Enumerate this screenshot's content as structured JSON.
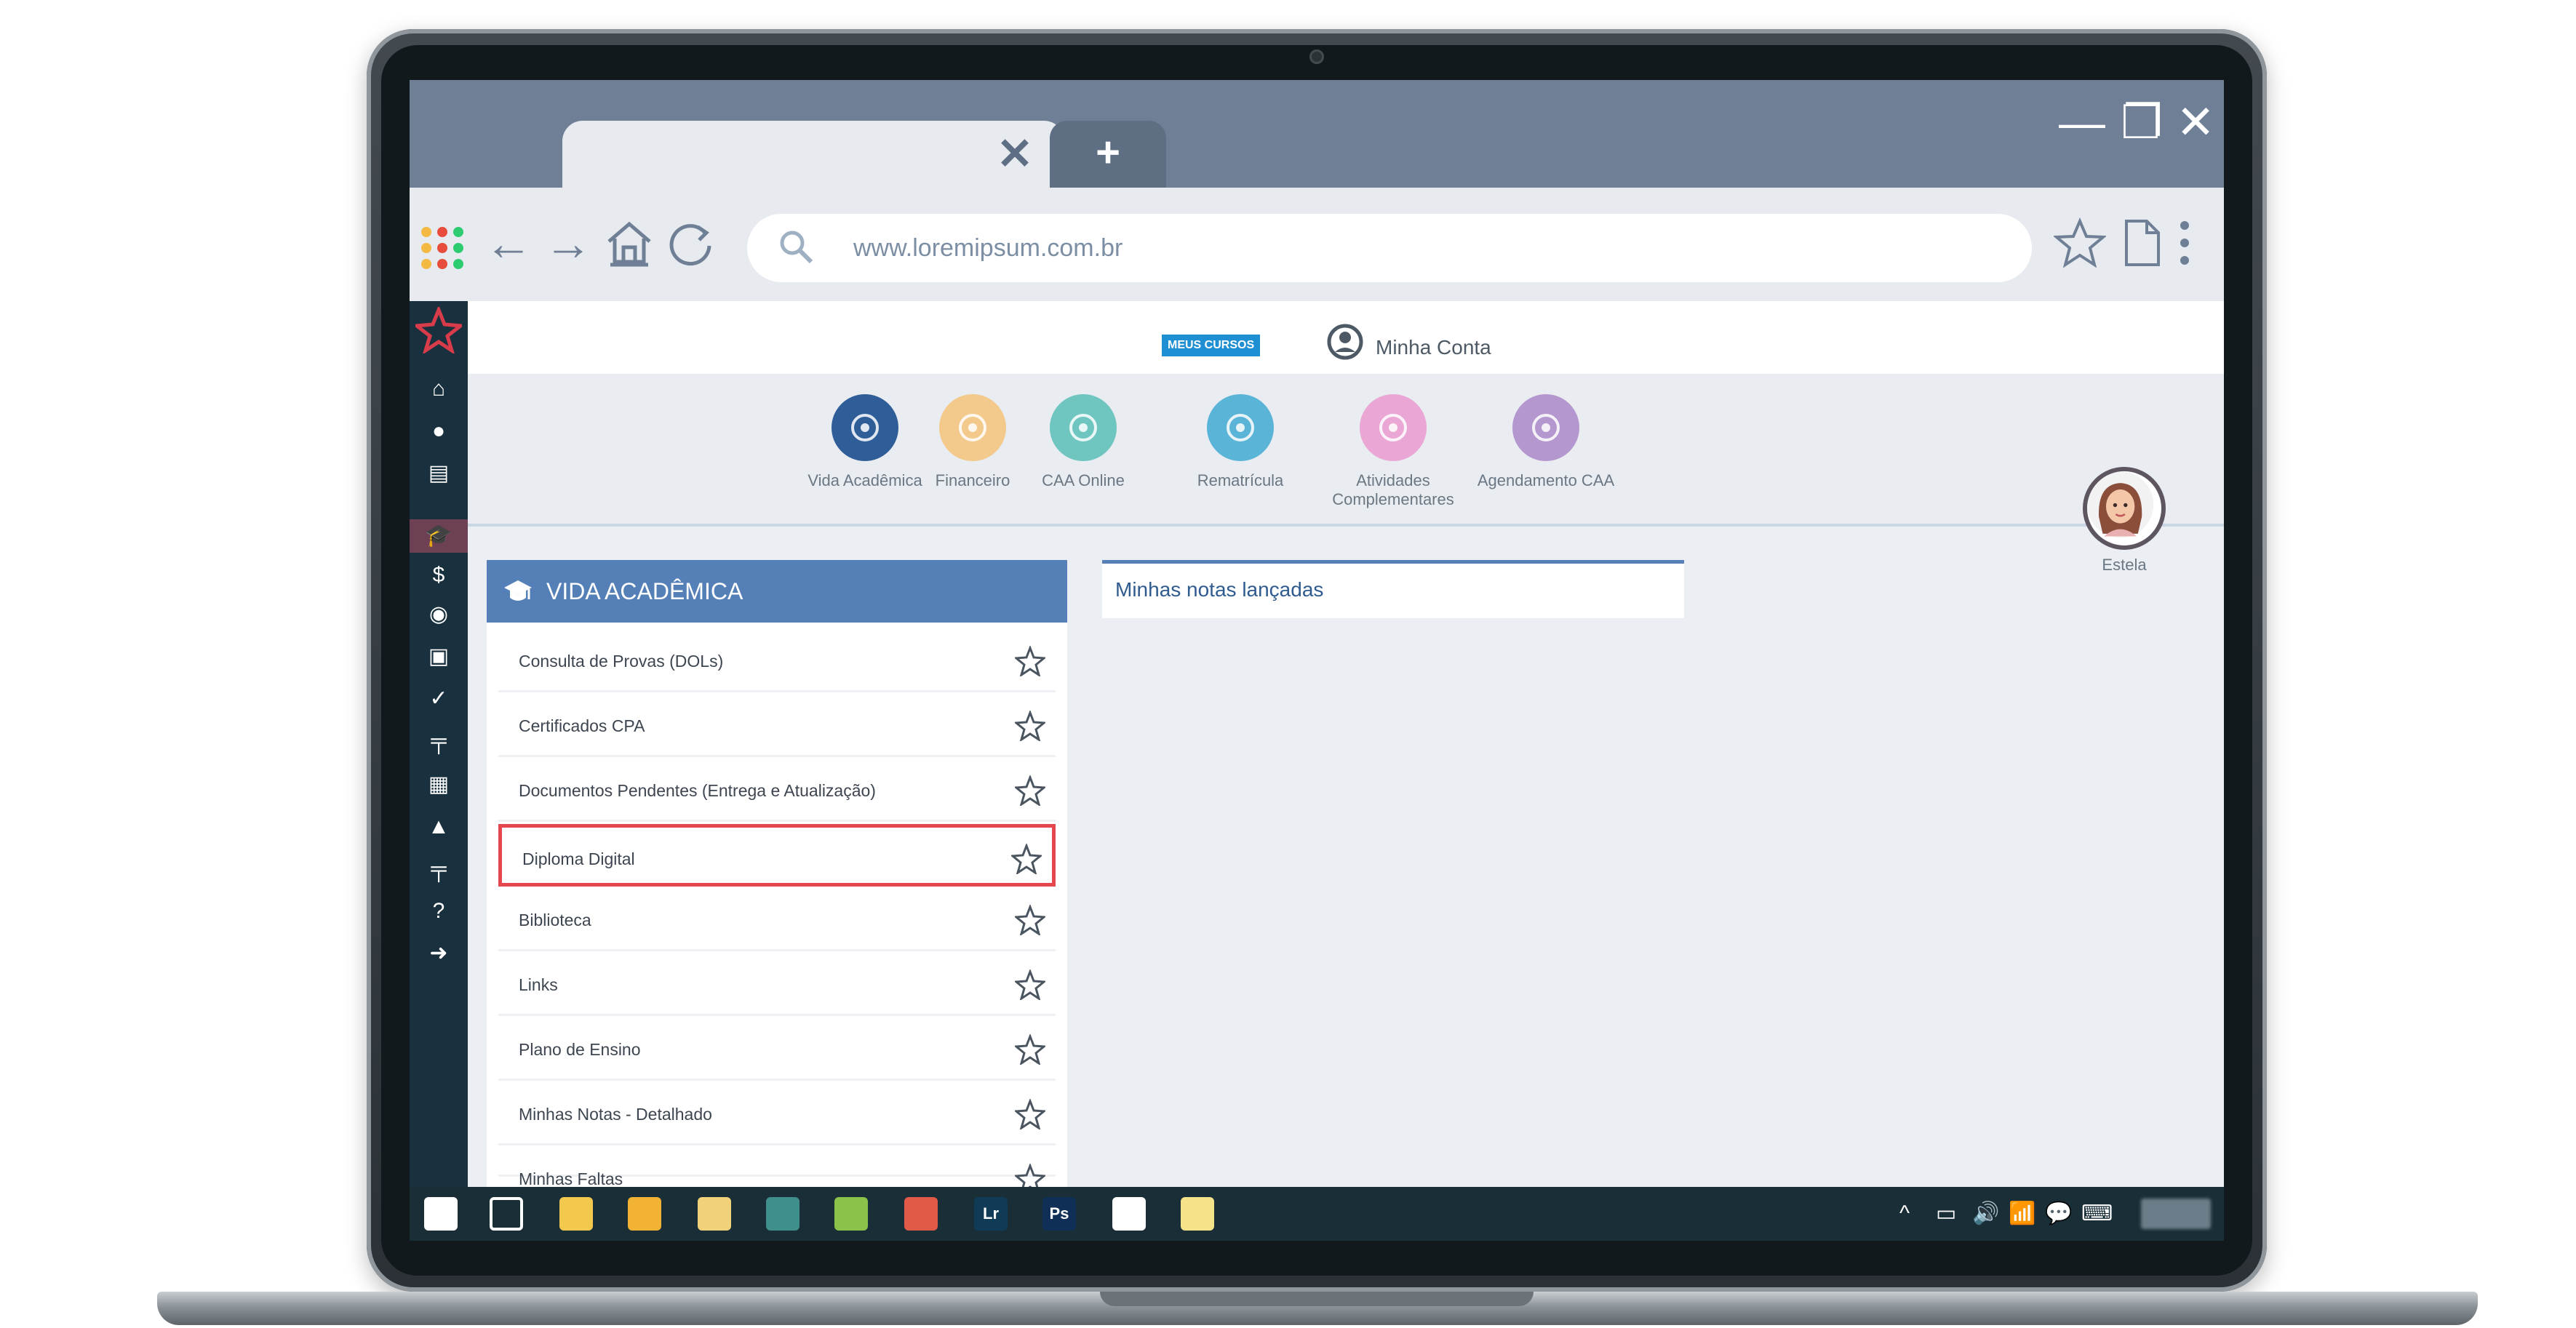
{
  "browser": {
    "tab_close": "✕",
    "new_tab": "+",
    "window_controls": {
      "minimize": "—",
      "restore": "❐",
      "close": "✕"
    },
    "url": "www.loremipsum.com.br",
    "nav_icons": [
      "apps-icon",
      "back-arrow-icon",
      "forward-arrow-icon",
      "home-icon",
      "reload-icon",
      "search-icon",
      "star-icon",
      "page-icon",
      "more-vertical-icon"
    ]
  },
  "sidebar": {
    "items": [
      {
        "icon": "home-icon",
        "glyph": "⌂"
      },
      {
        "icon": "user-icon",
        "glyph": "●"
      },
      {
        "icon": "calendar-icon",
        "glyph": "▤"
      },
      {
        "icon": "graduation-cap-icon",
        "glyph": "🎓"
      },
      {
        "icon": "dollar-icon",
        "glyph": "$"
      },
      {
        "icon": "globe-icon",
        "glyph": "◉"
      },
      {
        "icon": "id-card-icon",
        "glyph": "▣"
      },
      {
        "icon": "check-circle-icon",
        "glyph": "✓"
      },
      {
        "icon": "signpost-icon",
        "glyph": "╤"
      },
      {
        "icon": "calendar-clock-icon",
        "glyph": "▦"
      },
      {
        "icon": "bell-icon",
        "glyph": "▲"
      },
      {
        "icon": "signpost-icon",
        "glyph": "╤"
      },
      {
        "icon": "help-icon",
        "glyph": "?"
      },
      {
        "icon": "logout-icon",
        "glyph": "➜"
      }
    ]
  },
  "header": {
    "badge": "MEUS CURSOS",
    "account": "Minha Conta"
  },
  "modules": [
    {
      "label": "Vida Acadêmica",
      "color": "#2e5d97"
    },
    {
      "label": "Financeiro",
      "color": "#f3c98c"
    },
    {
      "label": "CAA Online",
      "color": "#6fc6c0"
    },
    {
      "label": "Rematrícula",
      "color": "#5ab4d8"
    },
    {
      "label": "Atividades Complementares",
      "color": "#eaa6d4"
    },
    {
      "label": "Agendamento CAA",
      "color": "#b497cf"
    }
  ],
  "user": {
    "name": "Estela"
  },
  "panel": {
    "title": "VIDA ACADÊMICA",
    "items": [
      "Consulta de Provas (DOLs)",
      "Certificados CPA",
      "Documentos Pendentes (Entrega e Atualização)",
      "Diploma Digital",
      "Biblioteca",
      "Links",
      "Plano de Ensino",
      "Minhas Notas - Detalhado",
      "Minhas Faltas"
    ],
    "highlighted_index": 3
  },
  "notes_card": {
    "title": "Minhas notas lançadas"
  },
  "taskbar": {
    "apps": [
      {
        "name": "windows-start-icon",
        "label": "",
        "bg": "#ffffff"
      },
      {
        "name": "task-view-icon",
        "label": "",
        "bg": "transparent"
      },
      {
        "name": "file-explorer-icon",
        "label": "",
        "bg": "#f2c94c"
      },
      {
        "name": "chrome-icon",
        "label": "",
        "bg": "#f2b233"
      },
      {
        "name": "app-icon",
        "label": "",
        "bg": "#f1d27a"
      },
      {
        "name": "app-icon",
        "label": "",
        "bg": "#3f8f8c"
      },
      {
        "name": "app-icon",
        "label": "",
        "bg": "#8bc34a"
      },
      {
        "name": "app-icon",
        "label": "",
        "bg": "#e05a47"
      },
      {
        "name": "lightroom-icon",
        "label": "Lr",
        "bg": "#0f3b57"
      },
      {
        "name": "photoshop-icon",
        "label": "Ps",
        "bg": "#0f2f57"
      },
      {
        "name": "app-icon",
        "label": "",
        "bg": "#ffffff"
      },
      {
        "name": "app-icon",
        "label": "",
        "bg": "#f5e38a"
      }
    ],
    "tray": [
      "^",
      "▭",
      "🔊",
      "📶",
      "💬",
      "⌨"
    ]
  }
}
